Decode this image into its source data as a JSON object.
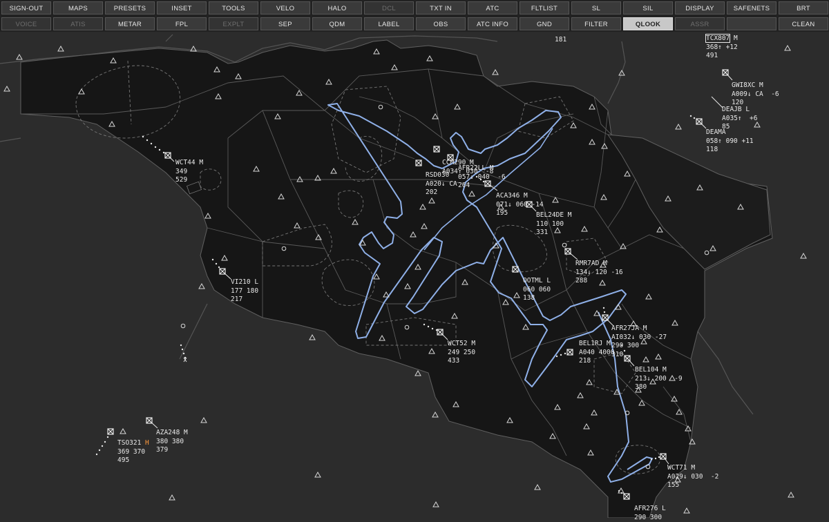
{
  "toolbar": {
    "row1": [
      {
        "label": "SIGN-OUT",
        "state": "normal"
      },
      {
        "label": "MAPS",
        "state": "normal"
      },
      {
        "label": "PRESETS",
        "state": "normal"
      },
      {
        "label": "INSET",
        "state": "normal"
      },
      {
        "label": "TOOLS",
        "state": "normal"
      },
      {
        "label": "VELO",
        "state": "normal"
      },
      {
        "label": "HALO",
        "state": "normal"
      },
      {
        "label": "DCL",
        "state": "disabled"
      },
      {
        "label": "TXT IN",
        "state": "normal"
      },
      {
        "label": "ATC",
        "state": "normal"
      },
      {
        "label": "FLTLIST",
        "state": "normal"
      },
      {
        "label": "SL",
        "state": "normal"
      },
      {
        "label": "SIL",
        "state": "normal"
      },
      {
        "label": "DISPLAY",
        "state": "normal"
      },
      {
        "label": "SAFENETS",
        "state": "normal"
      },
      {
        "label": "BRT",
        "state": "normal"
      }
    ],
    "row2": [
      {
        "label": "VOICE",
        "state": "disabled"
      },
      {
        "label": "ATIS",
        "state": "disabled"
      },
      {
        "label": "METAR",
        "state": "normal"
      },
      {
        "label": "FPL",
        "state": "normal"
      },
      {
        "label": "EXPLT",
        "state": "disabled"
      },
      {
        "label": "SEP",
        "state": "normal"
      },
      {
        "label": "QDM",
        "state": "normal"
      },
      {
        "label": "LABEL",
        "state": "normal"
      },
      {
        "label": "OBS",
        "state": "normal"
      },
      {
        "label": "ATC INFO",
        "state": "normal"
      },
      {
        "label": "GND",
        "state": "normal"
      },
      {
        "label": "FILTER",
        "state": "normal"
      },
      {
        "label": "QLOOK",
        "state": "active"
      },
      {
        "label": "ASSR",
        "state": "disabled"
      },
      {
        "label": "",
        "state": "normal"
      },
      {
        "label": "CLEAN",
        "state": "normal"
      }
    ]
  },
  "colors": {
    "background": "#2c2c2c",
    "territory": "#151515",
    "route": "#8fb0e8",
    "text": "#e8e8e8",
    "warning": "#ff9a3c"
  },
  "loose_labels": [
    {
      "id": "l181",
      "text": "181"
    }
  ],
  "tracks": [
    {
      "id": "t1",
      "lines": [
        "TCX807 M",
        "368↑ +12",
        "491"
      ],
      "boxed_callsign": true
    },
    {
      "id": "t2",
      "lines": [
        "GWI8XC M",
        "A009↓ CA  -6",
        "120"
      ]
    },
    {
      "id": "t3",
      "lines": [
        "DEAJB L",
        "A035↑  +6",
        "85"
      ]
    },
    {
      "id": "t4",
      "lines": [
        "DEAMA",
        "058↑ 090 +11",
        "118"
      ]
    },
    {
      "id": "t5",
      "lines": [
        "WCT44 M",
        "349",
        "529"
      ]
    },
    {
      "id": "t6",
      "lines": [
        "CCM290 M",
        "A034↑ 030  -8"
      ]
    },
    {
      "id": "t7",
      "lines": [
        "AFR22LL M",
        "057↓ 040  -6",
        "264"
      ]
    },
    {
      "id": "t8",
      "lines": [
        "RSD030",
        "A020↓ CA",
        "202"
      ]
    },
    {
      "id": "t9",
      "lines": [
        "ACA346 M",
        "071↓ 060 -14",
        "195"
      ]
    },
    {
      "id": "t10",
      "lines": [
        "BEL24DE M",
        "110 100",
        "331"
      ]
    },
    {
      "id": "t11",
      "lines": [
        "VI210 L",
        "177 180",
        "217"
      ]
    },
    {
      "id": "t12",
      "lines": [
        "RMR7AD M",
        "134↓ 120 -16",
        "288"
      ]
    },
    {
      "id": "t13",
      "lines": [
        "OOTML L",
        "060 060",
        "138"
      ]
    },
    {
      "id": "t14",
      "lines": [
        "AFR27JA M",
        "AI032↓ 030 -27",
        "290 300",
        "310"
      ]
    },
    {
      "id": "t15",
      "lines": [
        "WCT52 M",
        "249 250",
        "433"
      ]
    },
    {
      "id": "t16",
      "lines": [
        "BEL1RJ M",
        "A040 4000",
        "218"
      ]
    },
    {
      "id": "t17",
      "lines": [
        "BEL104 M",
        "213↓ 200  -9",
        "380"
      ]
    },
    {
      "id": "t18",
      "lines": [
        "AZA248 M",
        "380 380",
        "379"
      ]
    },
    {
      "id": "t19",
      "lines": [
        "TSO321",
        "369 370",
        "495"
      ],
      "flag": "H"
    },
    {
      "id": "t20",
      "lines": [
        "WCT71 M",
        "A029↓ 030  -2",
        "155"
      ]
    },
    {
      "id": "t21",
      "lines": [
        "AFR276 L",
        "290 300"
      ]
    }
  ]
}
